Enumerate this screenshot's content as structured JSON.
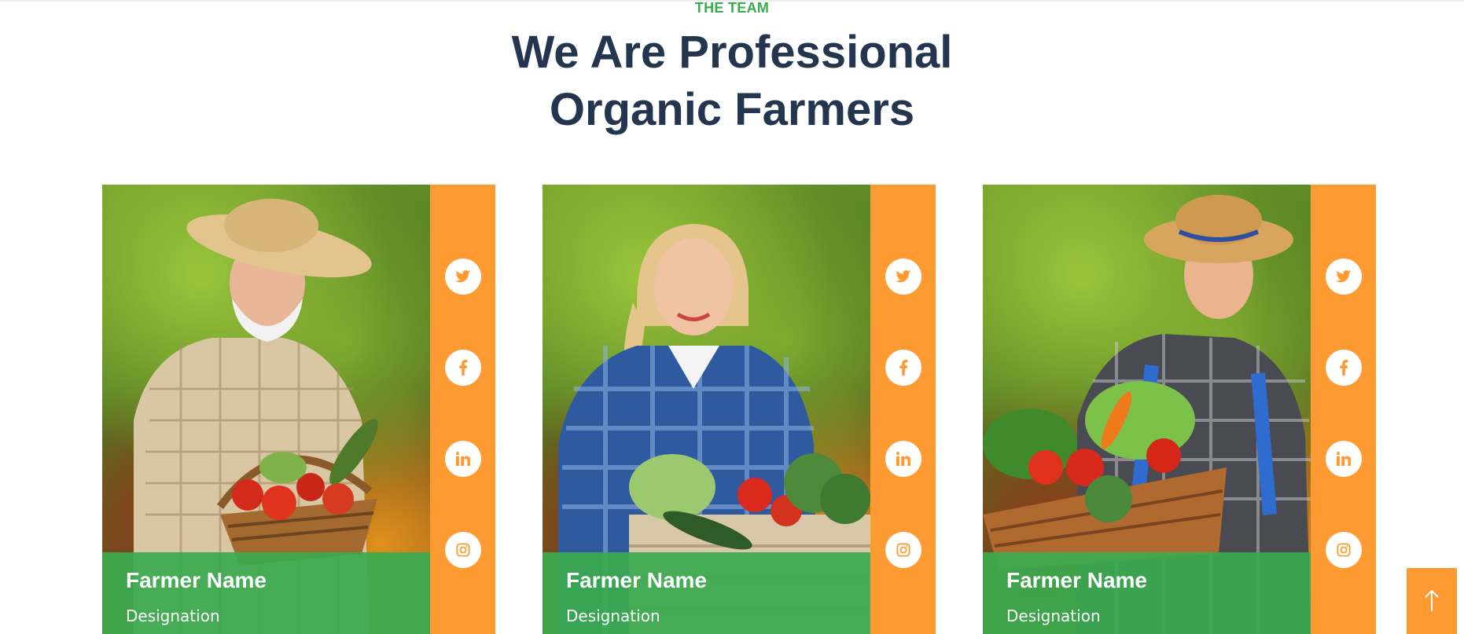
{
  "section": {
    "eyebrow": "THE TEAM",
    "title_line1": "We Are Professional",
    "title_line2": "Organic Farmers"
  },
  "team": [
    {
      "name": "Farmer Name",
      "designation": "Designation",
      "photo": "older farmer with straw hat holding basket of vegetables"
    },
    {
      "name": "Farmer Name",
      "designation": "Designation",
      "photo": "young woman in blue plaid shirt holding crate of vegetables"
    },
    {
      "name": "Farmer Name",
      "designation": "Designation",
      "photo": "young man in straw hat and overalls holding basket of vegetables"
    }
  ],
  "social_icons": [
    "twitter-icon",
    "facebook-icon",
    "linkedin-icon",
    "instagram-icon"
  ],
  "scroll_top_icon": "arrow-up-icon",
  "colors": {
    "accent_green": "#3aaa4f",
    "heading_navy": "#243550",
    "social_orange": "#fd9a31",
    "white": "#ffffff"
  }
}
